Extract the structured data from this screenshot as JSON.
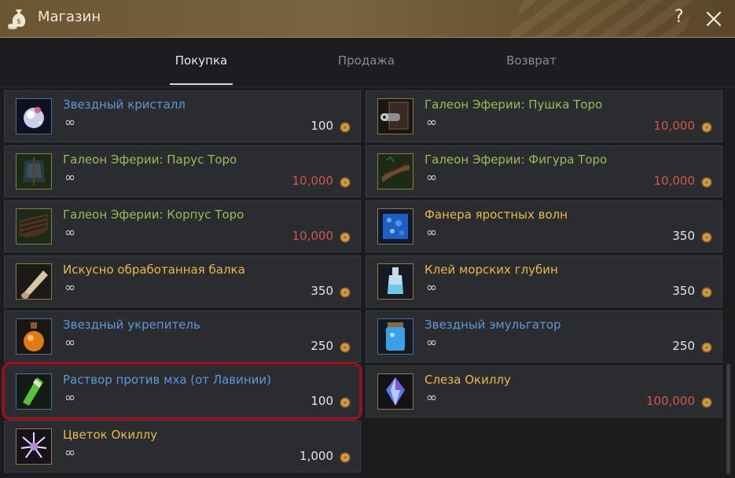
{
  "window": {
    "title": "Магазин",
    "help_glyph": "?",
    "icons": {
      "app": "coin-bag-icon",
      "help": "question-mark-icon",
      "close": "close-icon"
    }
  },
  "tabs": [
    {
      "label": "Покупка",
      "active": true
    },
    {
      "label": "Продажа",
      "active": false
    },
    {
      "label": "Возврат",
      "active": false
    }
  ],
  "currency_icon": "silver-coin-icon",
  "infinity": "∞",
  "items": [
    {
      "name": "Звездный кристалл",
      "price": "100",
      "name_color": "blue",
      "price_red": false,
      "icon": "star-crystal-icon",
      "highlighted": false
    },
    {
      "name": "Галеон Эферии: Пушка Торо",
      "price": "10,000",
      "name_color": "green",
      "price_red": true,
      "icon": "cannon-icon",
      "highlighted": false
    },
    {
      "name": "Галеон Эферии: Парус Торо",
      "price": "10,000",
      "name_color": "green",
      "price_red": true,
      "icon": "sail-icon",
      "highlighted": false
    },
    {
      "name": "Галеон Эферии: Фигура Торо",
      "price": "10,000",
      "name_color": "green",
      "price_red": true,
      "icon": "figurehead-icon",
      "highlighted": false
    },
    {
      "name": "Галеон Эферии: Корпус Торо",
      "price": "10,000",
      "name_color": "green",
      "price_red": true,
      "icon": "hull-icon",
      "highlighted": false
    },
    {
      "name": "Фанера яростных волн",
      "price": "350",
      "name_color": "gold",
      "price_red": false,
      "icon": "plywood-icon",
      "highlighted": false
    },
    {
      "name": "Искусно обработанная балка",
      "price": "350",
      "name_color": "gold",
      "price_red": false,
      "icon": "timber-icon",
      "highlighted": false
    },
    {
      "name": "Клей морских глубин",
      "price": "350",
      "name_color": "gold",
      "price_red": false,
      "icon": "glue-bottle-icon",
      "highlighted": false
    },
    {
      "name": "Звездный укрепитель",
      "price": "250",
      "name_color": "blue",
      "price_red": false,
      "icon": "orange-potion-icon",
      "highlighted": false
    },
    {
      "name": "Звездный эмульгатор",
      "price": "250",
      "name_color": "blue",
      "price_red": false,
      "icon": "blue-jar-icon",
      "highlighted": false
    },
    {
      "name": "Раствор против мха (от Лавинии)",
      "price": "100",
      "name_color": "blue",
      "price_red": false,
      "icon": "green-vial-icon",
      "highlighted": true
    },
    {
      "name": "Слеза Окиллу",
      "price": "100,000",
      "name_color": "gold",
      "price_red": true,
      "icon": "crystal-tear-icon",
      "highlighted": false
    },
    {
      "name": "Цветок Окиллу",
      "price": "1,000",
      "name_color": "gold",
      "price_red": false,
      "icon": "flower-icon",
      "highlighted": false
    }
  ]
}
